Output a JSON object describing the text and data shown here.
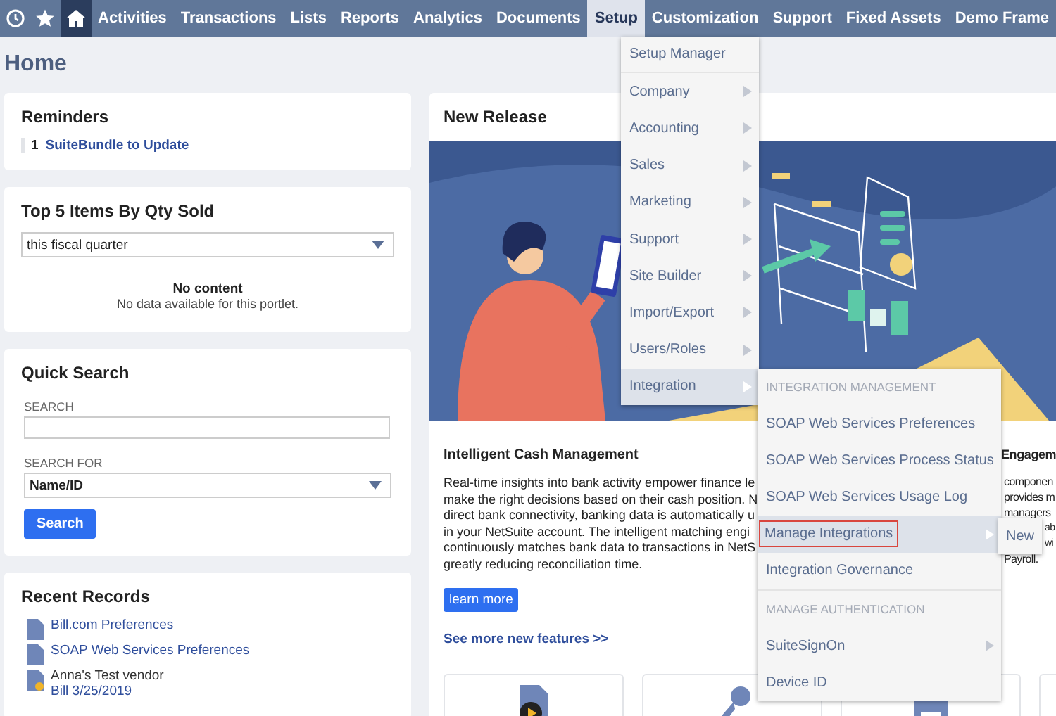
{
  "nav": {
    "icon_buttons": [
      {
        "kind": "recent",
        "selected": false
      },
      {
        "kind": "star",
        "selected": false
      },
      {
        "kind": "home",
        "selected": true
      }
    ],
    "items": [
      {
        "label": "Activities",
        "selected": false
      },
      {
        "label": "Transactions",
        "selected": false
      },
      {
        "label": "Lists",
        "selected": false
      },
      {
        "label": "Reports",
        "selected": false
      },
      {
        "label": "Analytics",
        "selected": false
      },
      {
        "label": "Documents",
        "selected": false
      },
      {
        "label": "Setup",
        "selected": true
      },
      {
        "label": "Customization",
        "selected": false
      },
      {
        "label": "Support",
        "selected": false
      },
      {
        "label": "Fixed Assets",
        "selected": false
      },
      {
        "label": "Demo Frame",
        "selected": false
      }
    ]
  },
  "page_title": "Home",
  "reminders": {
    "title": "Reminders",
    "items": [
      {
        "count": "1",
        "label": "SuiteBundle to Update"
      }
    ]
  },
  "top_items": {
    "title": "Top 5 Items By Qty Sold",
    "period": "this fiscal quarter",
    "empty_title": "No content",
    "empty_text": "No data available for this portlet."
  },
  "quick_search": {
    "title": "Quick Search",
    "search_label": "SEARCH",
    "search_for_label": "SEARCH FOR",
    "search_for": "Name/ID",
    "button": "Search"
  },
  "recent_records": {
    "title": "Recent Records",
    "items": [
      {
        "kind": "page",
        "lines": [
          "Bill.com Preferences"
        ]
      },
      {
        "kind": "page",
        "lines": [
          "SOAP Web Services Preferences"
        ]
      },
      {
        "kind": "record",
        "lines": [
          "Anna's Test vendor",
          "Bill 3/25/2019"
        ]
      }
    ]
  },
  "new_release": {
    "title": "New Release",
    "article": {
      "title": "Intelligent Cash Management",
      "lines": [
        "Real-time insights into bank activity empower finance le",
        "make the right decisions based on their cash position. N",
        "direct bank connectivity, banking data is automatically u",
        "in your NetSuite account. The intelligent matching engi",
        "continuously matches bank data to transactions in NetS",
        "greatly reducing reconciliation time."
      ],
      "button": "learn more"
    },
    "side_article": {
      "title": "Engagem",
      "lines": [
        "componen",
        "provides m",
        "managers",
        "ab",
        "wi",
        "Payroll."
      ]
    },
    "more_link": "See more new features >>",
    "feature_cards": [
      {
        "kind": "video"
      },
      {
        "kind": "key"
      },
      {
        "kind": "document"
      },
      {
        "kind": "blank"
      }
    ]
  },
  "setup_menu": {
    "items": [
      {
        "label": "Setup Manager",
        "has_submenu": false,
        "selected": false
      },
      {
        "label": "Company",
        "has_submenu": true,
        "selected": false
      },
      {
        "label": "Accounting",
        "has_submenu": true,
        "selected": false
      },
      {
        "label": "Sales",
        "has_submenu": true,
        "selected": false
      },
      {
        "label": "Marketing",
        "has_submenu": true,
        "selected": false
      },
      {
        "label": "Support",
        "has_submenu": true,
        "selected": false
      },
      {
        "label": "Site Builder",
        "has_submenu": true,
        "selected": false
      },
      {
        "label": "Import/Export",
        "has_submenu": true,
        "selected": false
      },
      {
        "label": "Users/Roles",
        "has_submenu": true,
        "selected": false
      },
      {
        "label": "Integration",
        "has_submenu": true,
        "selected": true
      }
    ]
  },
  "integration_menu": {
    "items": [
      {
        "kind": "header",
        "label": "INTEGRATION MANAGEMENT"
      },
      {
        "kind": "item",
        "label": "SOAP Web Services Preferences",
        "has_submenu": false,
        "selected": false
      },
      {
        "kind": "item",
        "label": "SOAP Web Services Process Status",
        "has_submenu": false,
        "selected": false
      },
      {
        "kind": "item",
        "label": "SOAP Web Services Usage Log",
        "has_submenu": false,
        "selected": false
      },
      {
        "kind": "item",
        "label": "Manage Integrations",
        "has_submenu": true,
        "selected": true
      },
      {
        "kind": "item",
        "label": "Integration Governance",
        "has_submenu": false,
        "selected": false
      },
      {
        "kind": "header",
        "label": "MANAGE AUTHENTICATION"
      },
      {
        "kind": "item",
        "label": "SuiteSignOn",
        "has_submenu": true,
        "selected": false
      },
      {
        "kind": "item",
        "label": "Device ID",
        "has_submenu": false,
        "selected": false
      }
    ]
  },
  "manage_menu": {
    "items": [
      "New"
    ]
  }
}
